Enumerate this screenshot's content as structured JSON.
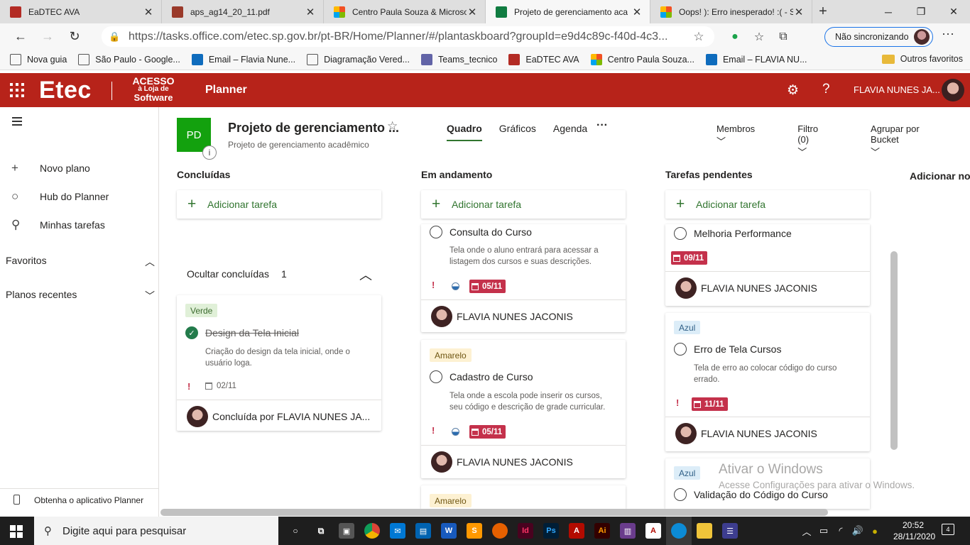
{
  "browser": {
    "tabs": [
      {
        "title": "EaDTEC AVA",
        "favicon_color": "#b32b24"
      },
      {
        "title": "aps_ag14_20_11.pdf",
        "favicon_color": "#9a3a2a"
      },
      {
        "title": "Centro Paula Souza & Microso",
        "favicon_color": "#f25022"
      },
      {
        "title": "Projeto de gerenciamento aca",
        "favicon_color": "#107c41"
      },
      {
        "title": "Oops! ): Erro inesperado! :( - Sy",
        "favicon_color": "#f25022"
      }
    ],
    "url": "https://tasks.office.com/etec.sp.gov.br/pt-BR/Home/Planner/#/plantaskboard?groupId=e9d4c89c-f40d-4c3...",
    "sync_label": "Não sincronizando",
    "bookmarks": [
      "Nova guia",
      "São Paulo - Google...",
      "Email – Flavia Nune...",
      "Diagramação Vered...",
      "Teams_tecnico",
      "EaDTEC AVA",
      "Centro Paula Souza...",
      "Email – FLAVIA NU..."
    ],
    "other_favorites": "Outros favoritos"
  },
  "suite": {
    "brand": "Etec",
    "brand_sub": [
      "ACESSO",
      "à Loja de",
      "Software"
    ],
    "app": "Planner",
    "user": "FLAVIA NUNES JA...",
    "color": "#b7231a"
  },
  "nav": {
    "items": [
      "Novo plano",
      "Hub do Planner",
      "Minhas tarefas"
    ],
    "favorites": "Favoritos",
    "recent": "Planos recentes",
    "get_app": "Obtenha o aplicativo Planner"
  },
  "plan": {
    "initials": "PD",
    "title": "Projeto de gerenciamento ...",
    "subtitle": "Projeto de gerenciamento acadêmico",
    "pivots": [
      "Quadro",
      "Gráficos",
      "Agenda"
    ],
    "filters": [
      "Membros",
      "Filtro (0)",
      "Agrupar por Bucket"
    ]
  },
  "board": {
    "add_task": "Adicionar tarefa",
    "add_bucket": "Adicionar nov",
    "buckets": [
      {
        "title": "Concluídas"
      },
      {
        "title": "Em andamento"
      },
      {
        "title": "Tarefas pendentes"
      }
    ],
    "completed_toggle": {
      "label": "Ocultar concluídas",
      "count": "1"
    },
    "cards": {
      "done1": {
        "label": "Verde",
        "title": "Design da Tela Inicial",
        "desc": "Criação do design da tela inicial, onde o usuário loga.",
        "due": "02/11",
        "footer": "Concluída por FLAVIA NUNES JA..."
      },
      "prog1": {
        "title": "Consulta do Curso",
        "desc": "Tela onde o aluno entrará para acessar a listagem dos cursos e suas descrições.",
        "due": "05/11",
        "assignee": "FLAVIA NUNES JACONIS"
      },
      "prog2": {
        "label": "Amarelo",
        "title": "Cadastro de Curso",
        "desc": "Tela onde a escola pode inserir os cursos, seu código e descrição de grade curricular.",
        "due": "05/11",
        "assignee": "FLAVIA NUNES JACONIS"
      },
      "prog3": {
        "label": "Amarelo"
      },
      "pend1": {
        "title": "Melhoria Performance",
        "due": "09/11",
        "assignee": "FLAVIA NUNES JACONIS"
      },
      "pend2": {
        "label": "Azul",
        "title": "Erro de Tela Cursos",
        "desc": "Tela de erro ao colocar código do curso errado.",
        "due": "11/11",
        "assignee": "FLAVIA NUNES JACONIS"
      },
      "pend3": {
        "label": "Azul",
        "title": "Validação do Código do Curso"
      }
    }
  },
  "watermark": {
    "line1": "Ativar o Windows",
    "line2": "Acesse Configurações para ativar o Windows."
  },
  "taskbar": {
    "search_placeholder": "Digite aqui para pesquisar",
    "time": "20:52",
    "date": "28/11/2020",
    "notifications": "4"
  }
}
